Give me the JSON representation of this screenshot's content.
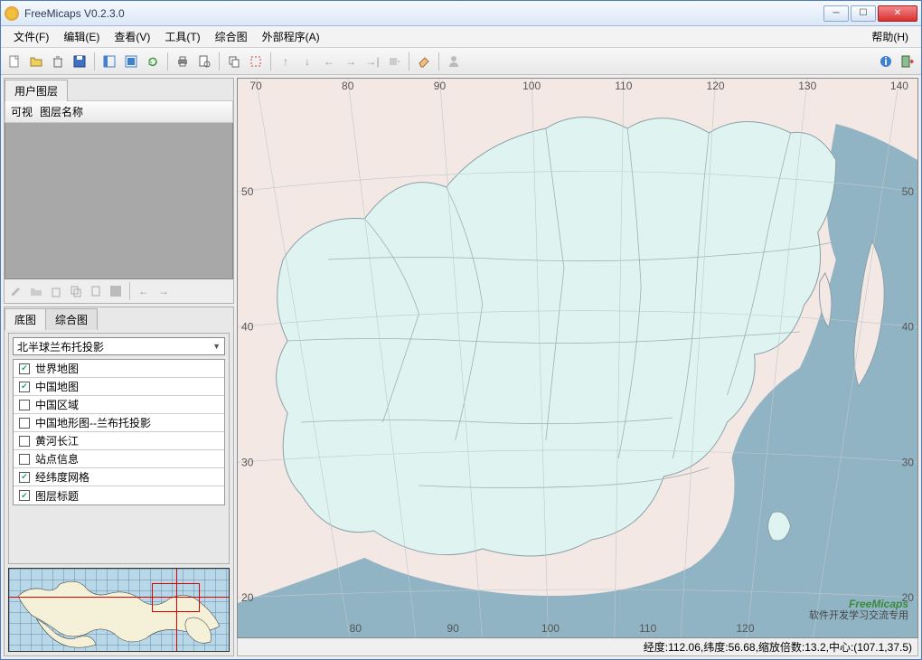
{
  "window": {
    "title": "FreeMicaps V0.2.3.0"
  },
  "menu": {
    "file": "文件(F)",
    "edit": "编辑(E)",
    "view": "查看(V)",
    "tools": "工具(T)",
    "composite": "综合图",
    "external": "外部程序(A)",
    "help": "帮助(H)"
  },
  "panels": {
    "user_layers_tab": "用户图层",
    "col_visible": "可视",
    "col_name": "图层名称",
    "basemap_tab": "底图",
    "composite_tab": "综合图"
  },
  "projection": {
    "selected": "北半球兰布托投影"
  },
  "basemap_layers": [
    {
      "label": "世界地图",
      "checked": true
    },
    {
      "label": "中国地图",
      "checked": true
    },
    {
      "label": "中国区域",
      "checked": false
    },
    {
      "label": "中国地形图--兰布托投影",
      "checked": false
    },
    {
      "label": "黄河长江",
      "checked": false
    },
    {
      "label": "站点信息",
      "checked": false
    },
    {
      "label": "经纬度网格",
      "checked": true
    },
    {
      "label": "图层标题",
      "checked": true
    }
  ],
  "map": {
    "lon_ticks_top": [
      "70",
      "80",
      "90",
      "100",
      "110",
      "120",
      "130",
      "140"
    ],
    "lon_ticks_bottom": [
      "80",
      "90",
      "100",
      "110",
      "120"
    ],
    "lat_ticks_left": [
      "50",
      "40",
      "30",
      "20"
    ],
    "lat_ticks_right": [
      "50",
      "40",
      "30",
      "20"
    ],
    "watermark_title": "FreeMicaps",
    "watermark_sub": "软件开发学习交流专用"
  },
  "status": {
    "text": "经度:112.06,纬度:56.68,缩放倍数:13.2,中心:(107.1,37.5)"
  }
}
